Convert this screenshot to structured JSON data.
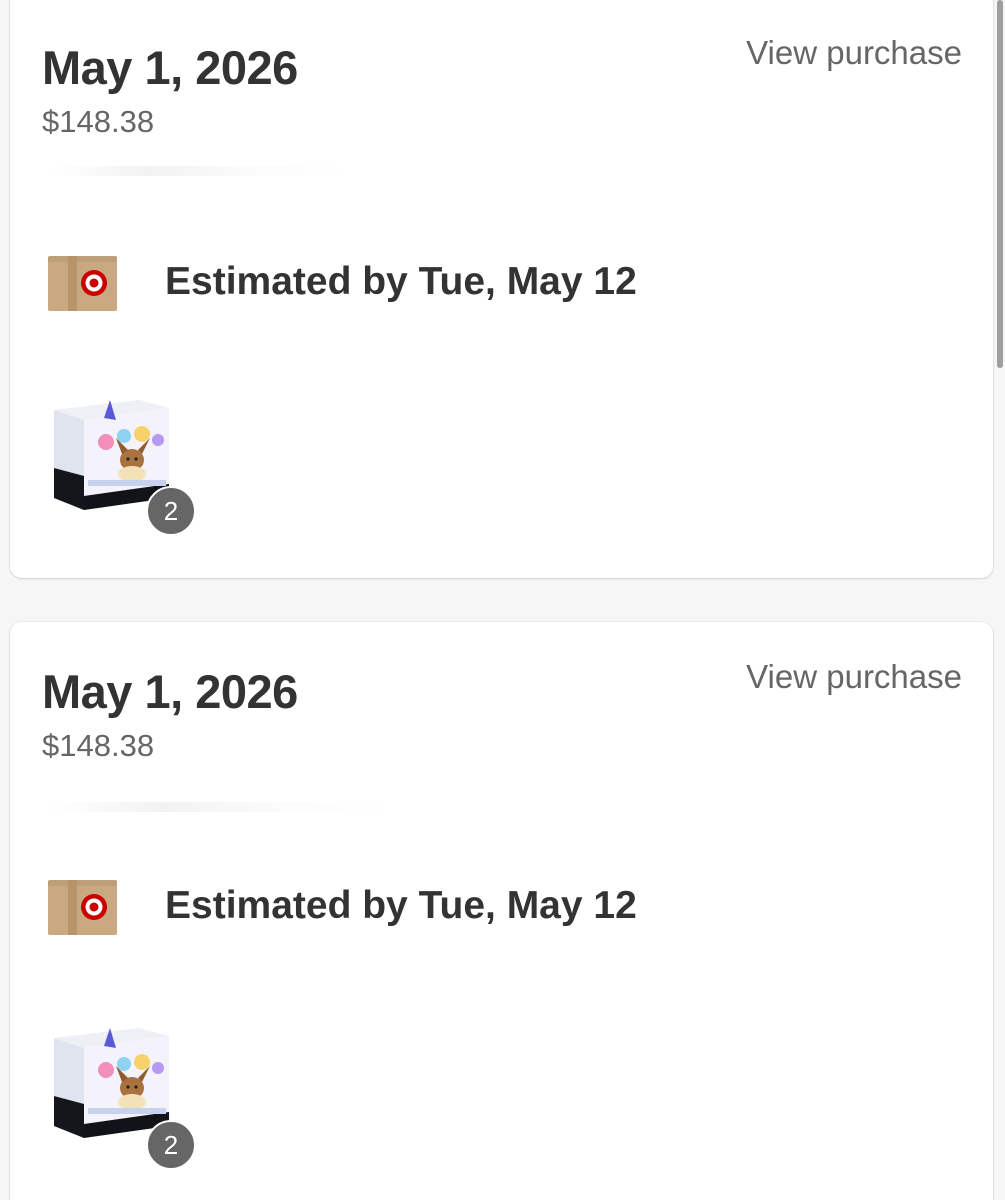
{
  "orders": [
    {
      "date": "May 1, 2026",
      "total": "$148.38",
      "view_label": "View purchase",
      "delivery": "Estimated by Tue, May 12",
      "shipping_icon": "target-shipping-box-icon",
      "item_icon": "pokemon-tcg-elite-trainer-box",
      "quantity": "2"
    },
    {
      "date": "May 1, 2026",
      "total": "$148.38",
      "view_label": "View purchase",
      "delivery": "Estimated by Tue, May 12",
      "shipping_icon": "target-shipping-box-icon",
      "item_icon": "pokemon-tcg-elite-trainer-box",
      "quantity": "2"
    }
  ],
  "colors": {
    "background": "#f6f6f6",
    "card": "#ffffff",
    "heading_text": "#333333",
    "secondary_text": "#666666",
    "badge": "#666666",
    "target_red": "#cc0000",
    "box_brown": "#c9a982"
  }
}
